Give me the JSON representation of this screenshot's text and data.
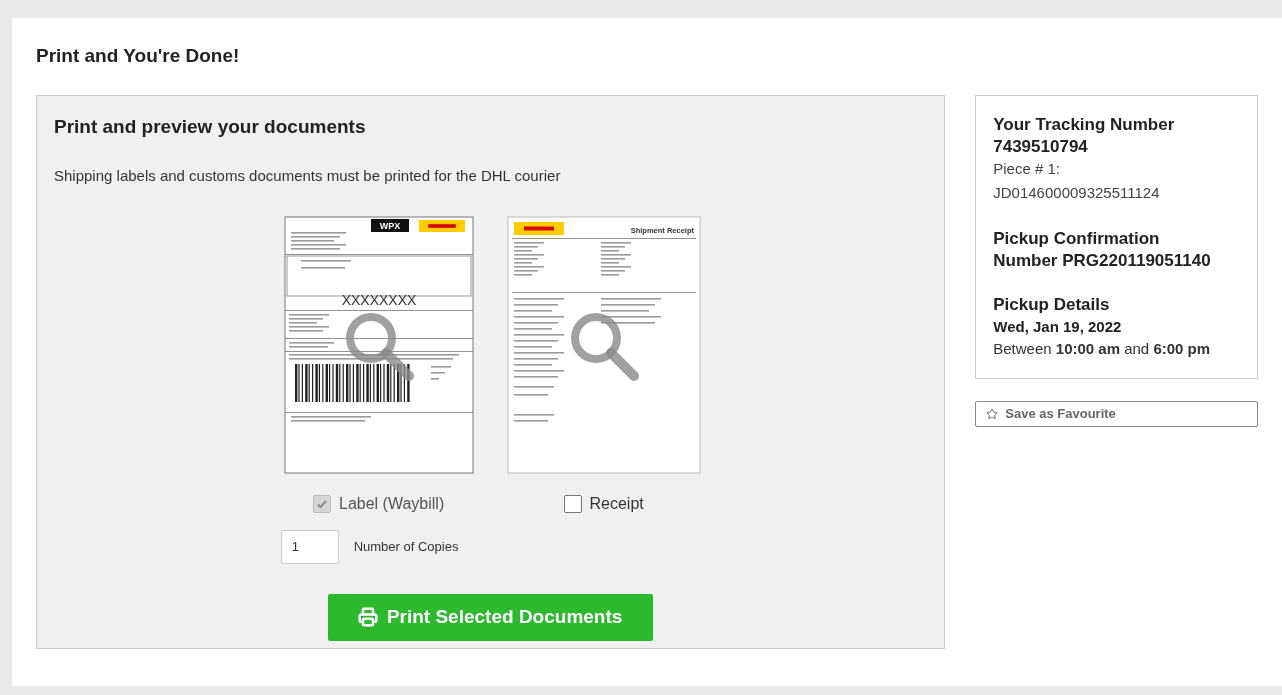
{
  "page_title": "Print and You're Done!",
  "documents_panel": {
    "title": "Print and preview your documents",
    "note": "Shipping labels and customs documents must be printed for the DHL courier",
    "documents": [
      {
        "kind": "waybill",
        "texts": [
          "WPX",
          "XXXXXXXX"
        ],
        "label": "Label (Waybill)",
        "checked": true,
        "disabled": true
      },
      {
        "kind": "receipt",
        "texts": [
          "Shipment Receipt"
        ],
        "label": "Receipt",
        "checked": false,
        "disabled": false
      }
    ],
    "copies": {
      "value": "1",
      "label": "Number of Copies"
    },
    "print_button": "Print Selected Documents"
  },
  "summary": {
    "tracking_heading": "Your Tracking Number",
    "tracking_number": "7439510794",
    "piece_label": "Piece # 1:",
    "piece_number": "JD014600009325511124",
    "confirmation": "Pickup Confirmation Number PRG220119051140",
    "details_heading": "Pickup Details",
    "date": "Wed, Jan 19, 2022",
    "window": "Between **10:00 am** and **6:00 pm**"
  },
  "save_button": "Save as Favourite"
}
